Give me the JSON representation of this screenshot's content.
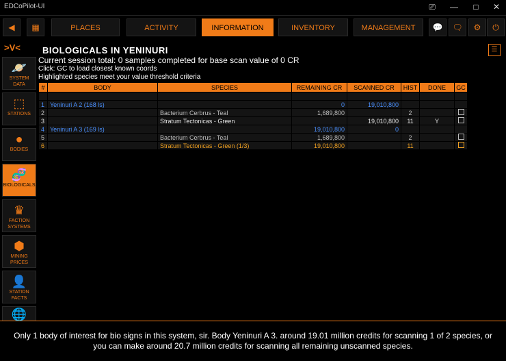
{
  "window": {
    "title": "EDCoPilot-UI",
    "controls": [
      "⎚",
      "—",
      "□",
      "✕"
    ]
  },
  "nav": {
    "back": "◀",
    "grid": "▦",
    "tabs": [
      {
        "label": "PLACES",
        "active": false
      },
      {
        "label": "ACTIVITY",
        "active": false
      },
      {
        "label": "INFORMATION",
        "active": true
      },
      {
        "label": "INVENTORY",
        "active": false
      },
      {
        "label": "MANAGEMENT",
        "active": false
      }
    ],
    "icons": {
      "chat": "💬",
      "messages": "🗨",
      "settings": "⚙",
      "power": "⏻"
    }
  },
  "sidebar": {
    "logo": ">V<",
    "items": [
      {
        "label": "SYSTEM DATA",
        "icon": "🪐",
        "active": false
      },
      {
        "label": "STATIONS",
        "icon": "⬚",
        "active": false
      },
      {
        "label": "BODIES",
        "icon": "●",
        "active": false
      },
      {
        "label": "BIOLOGICALS",
        "icon": "🧬",
        "active": true
      },
      {
        "label": "FACTION SYSTEMS",
        "icon": "♛",
        "active": false
      },
      {
        "label": "MINING PRICES",
        "icon": "⬢",
        "active": false
      },
      {
        "label": "STATION FACTS",
        "icon": "👤",
        "active": false
      },
      {
        "label": "",
        "icon": "🌐",
        "active": false
      }
    ]
  },
  "main": {
    "title": "BIOLOGICALS IN YENINURI",
    "session": "Current session total: 0 samples completed for base scan value of 0 CR",
    "click_hint": "Click:  GC to load closest known coords",
    "highlight_hint": "Highlighted species meet your value threshold criteria",
    "toggle_icon": "☰",
    "table": {
      "headers": [
        "#",
        "BODY",
        "SPECIES",
        "REMAINING CR",
        "SCANNED CR",
        "HIST",
        "DONE",
        "GC"
      ],
      "rows": [
        {
          "style": "blue",
          "num": "1",
          "body": "Yeninuri A 2 (168 ls)",
          "species": "",
          "remaining": "0",
          "scanned": "19,010,800",
          "hist": "",
          "done": "",
          "gc": false
        },
        {
          "style": "dim",
          "num": "2",
          "body": "",
          "species": "Bacterium Cerbrus - Teal",
          "remaining": "1,689,800",
          "scanned": "",
          "hist": "2",
          "done": "",
          "gc": true
        },
        {
          "style": "norm",
          "num": "3",
          "body": "",
          "species": "Stratum Tectonicas - Green",
          "remaining": "",
          "scanned": "19,010,800",
          "hist": "11",
          "done": "Y",
          "gc": true
        },
        {
          "style": "blue",
          "num": "4",
          "body": "Yeninuri A 3 (169 ls)",
          "species": "",
          "remaining": "19,010,800",
          "scanned": "0",
          "hist": "",
          "done": "",
          "gc": false
        },
        {
          "style": "dim",
          "num": "5",
          "body": "",
          "species": "Bacterium Cerbrus - Teal",
          "remaining": "1,689,800",
          "scanned": "",
          "hist": "2",
          "done": "",
          "gc": true
        },
        {
          "style": "gold",
          "num": "6",
          "body": "",
          "species": "Stratum Tectonicas - Green (1/3)",
          "remaining": "19,010,800",
          "scanned": "",
          "hist": "11",
          "done": "",
          "gc": true
        }
      ]
    }
  },
  "footer": {
    "message": "Only 1 body of interest for bio signs in this system, sir. Body Yeninuri A 3. around 19.01 million credits for scanning 1 of 2 species, or you can make around 20.7 million credits for scanning all remaining unscanned species."
  },
  "colors": {
    "accent": "#f07b18",
    "blue": "#4a90ff",
    "gold": "#f0a020"
  }
}
